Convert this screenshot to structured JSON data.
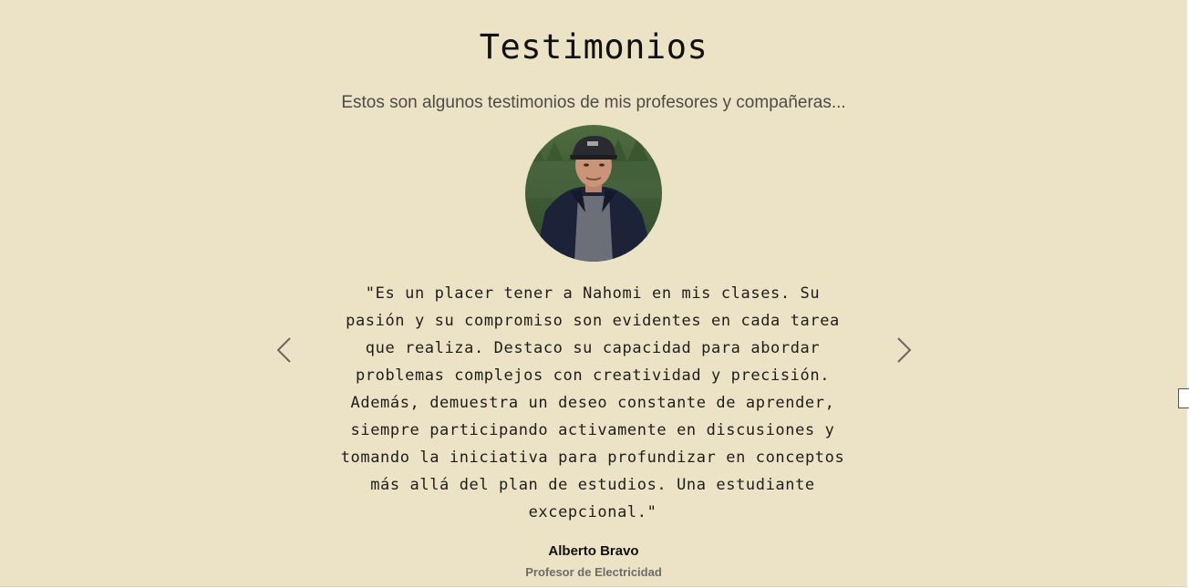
{
  "section": {
    "title": "Testimonios",
    "subtitle": "Estos son algunos testimonios de mis profesores y compañeras..."
  },
  "testimonial": {
    "quote": "\"Es un placer tener a Nahomi en mis clases. Su pasión y su compromiso son evidentes en cada tarea que realiza. Destaco su capacidad para abordar problemas complejos con creatividad y precisión. Además, demuestra un deseo constante de aprender, siempre participando activamente en discusiones y tomando la iniciativa para profundizar en conceptos más allá del plan de estudios. Una estudiante excepcional.\"",
    "author": "Alberto Bravo",
    "role": "Profesor de Electricidad"
  },
  "controls": {
    "prev_icon": "chevron-left-icon",
    "next_icon": "chevron-right-icon"
  },
  "colors": {
    "background": "#ece3c6",
    "title": "#111111",
    "subtitle": "#4f4a45",
    "role": "#6f6b66",
    "arrow": "#6b6560"
  }
}
